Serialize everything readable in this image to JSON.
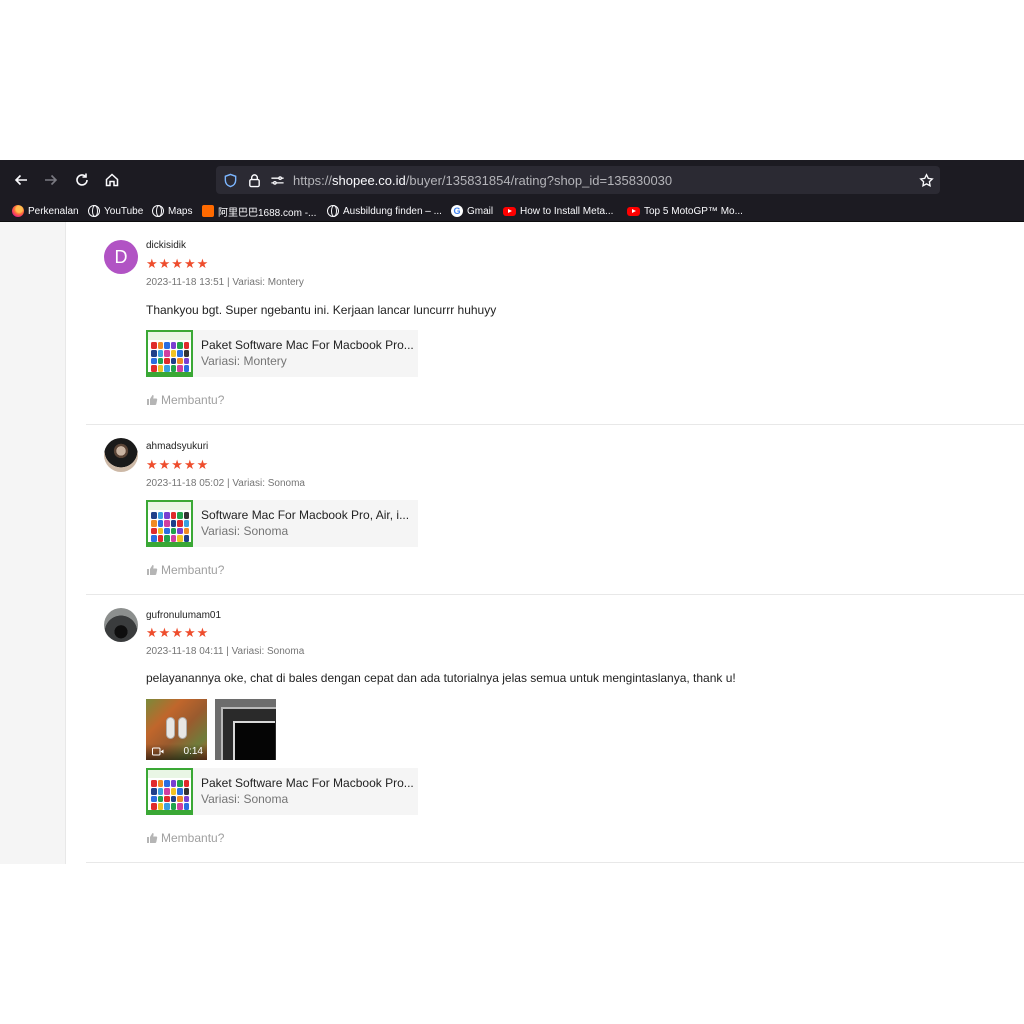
{
  "browser": {
    "url_prefix": "https://",
    "url_host": "shopee.co.id",
    "url_path": "/buyer/135831854/rating?shop_id=135830030",
    "bookmarks": [
      {
        "label": "Perkenalan",
        "icon": "firefox-icon"
      },
      {
        "label": "YouTube",
        "icon": "globe-icon"
      },
      {
        "label": "Maps",
        "icon": "globe-icon"
      },
      {
        "label": "阿里巴巴1688.com -...",
        "icon": "alibaba-icon"
      },
      {
        "label": "Ausbildung finden – ...",
        "icon": "globe-icon"
      },
      {
        "label": "Gmail",
        "icon": "google-icon"
      },
      {
        "label": "How to Install Meta...",
        "icon": "youtube-icon"
      },
      {
        "label": "Top 5 MotoGP™ Mo...",
        "icon": "youtube-icon"
      }
    ]
  },
  "colors": {
    "star": "#ee4d2d",
    "avatar_letter_bg": "#b153c4",
    "thumb_border": "#3aa835"
  },
  "reviews": [
    {
      "avatar_letter": "D",
      "username": "dickisidik",
      "rating": 5,
      "stars": "★★★★★",
      "meta": "2023-11-18 13:51 | Variasi: Montery",
      "comment": "Thankyou bgt. Super ngebantu ini. Kerjaan lancar luncurrr huhuyy",
      "product": {
        "name": "Paket Software Mac For Macbook Pro...",
        "variation": "Variasi: Montery"
      },
      "helpful": "Membantu?"
    },
    {
      "username": "ahmadsyukuri",
      "rating": 5,
      "stars": "★★★★★",
      "meta": "2023-11-18 05:02 | Variasi: Sonoma",
      "product": {
        "name": "Software Mac For Macbook Pro, Air, i...",
        "variation": "Variasi: Sonoma"
      },
      "helpful": "Membantu?"
    },
    {
      "username": "gufronulumam01",
      "rating": 5,
      "stars": "★★★★★",
      "meta": "2023-11-18 04:11 | Variasi: Sonoma",
      "comment": "pelayanannya oke, chat di bales dengan cepat dan ada tutorialnya jelas semua untuk mengintaslanya, thank u!",
      "video_duration": "0:14",
      "product": {
        "name": "Paket Software Mac For Macbook Pro...",
        "variation": "Variasi: Sonoma"
      },
      "helpful": "Membantu?"
    }
  ]
}
